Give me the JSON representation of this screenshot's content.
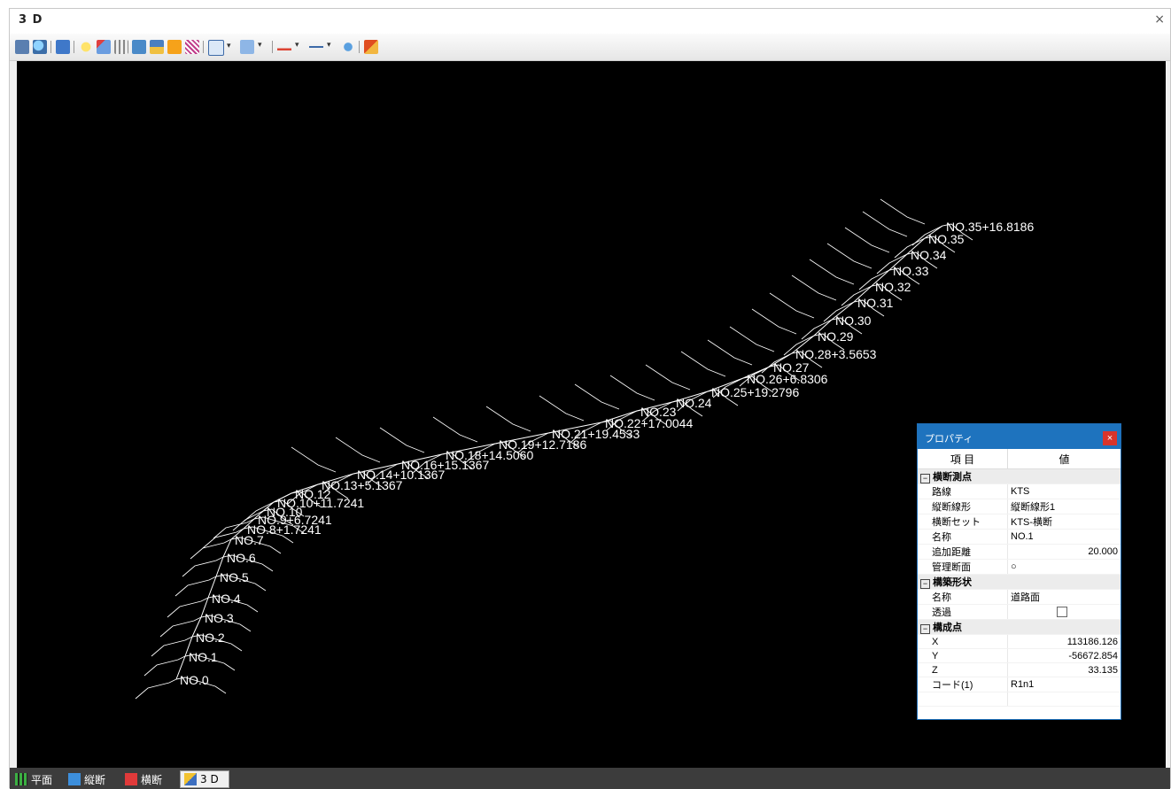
{
  "window": {
    "title": "3 D",
    "close_label": "×"
  },
  "toolbar": {
    "icons": [
      "save-icon",
      "search-icon",
      "view-icon",
      "light-icon",
      "paint-icon",
      "grid-icon",
      "layer-icon",
      "window-icon",
      "ip-icon",
      "wave-icon",
      "cube-icon",
      "face-icon",
      "measure-icon",
      "arrow-icon",
      "tool-icon",
      "export-icon"
    ]
  },
  "viewport": {
    "background": "#000000",
    "line_color": "#ffffff",
    "station_labels": [
      "NO.0",
      "NO.1",
      "NO.2",
      "NO.3",
      "NO.4",
      "NO.5",
      "NO.6",
      "NO.7",
      "NO.8+1.7241",
      "NO.9+6.7241",
      "NO.10",
      "NO.10+11.7241",
      "NO.12",
      "NO.13+5.1367",
      "NO.14+10.1367",
      "NO.16+15.1367",
      "NO.18+14.5060",
      "NO.19+12.7186",
      "NO.21+19.4533",
      "NO.22+17.0044",
      "NO.23",
      "NO.24",
      "NO.25+19.2796",
      "NO.26+6.8306",
      "NO.27",
      "NO.28+3.5653",
      "NO.29",
      "NO.30",
      "NO.31",
      "NO.32",
      "NO.33",
      "NO.34",
      "NO.35",
      "NO.35+16.8186"
    ]
  },
  "properties": {
    "title": "プロパティ",
    "col_item": "項 目",
    "col_value": "値",
    "sections": [
      {
        "title": "横断測点",
        "rows": [
          {
            "key": "路線",
            "value": "KTS"
          },
          {
            "key": "縦断線形",
            "value": "縦断線形1"
          },
          {
            "key": "横断セット",
            "value": "KTS-横断"
          },
          {
            "key": "名称",
            "value": "NO.1"
          },
          {
            "key": "追加距離",
            "value": "20.000"
          },
          {
            "key": "管理断面",
            "value": "○"
          }
        ]
      },
      {
        "title": "構築形状",
        "rows": [
          {
            "key": "名称",
            "value": "道路面"
          },
          {
            "key": "透過",
            "value": ""
          }
        ]
      },
      {
        "title": "構成点",
        "rows": [
          {
            "key": "X",
            "value": "113186.126"
          },
          {
            "key": "Y",
            "value": "-56672.854"
          },
          {
            "key": "Z",
            "value": "33.135"
          },
          {
            "key": "コード(1)",
            "value": "R1n1"
          }
        ]
      }
    ]
  },
  "tabs": [
    {
      "label": "平面",
      "icon": "plan-icon",
      "active": false
    },
    {
      "label": "縦断",
      "icon": "profile-icon",
      "active": false
    },
    {
      "label": "横断",
      "icon": "cross-section-icon",
      "active": false
    },
    {
      "label": "3 D",
      "icon": "3d-icon",
      "active": true
    }
  ]
}
